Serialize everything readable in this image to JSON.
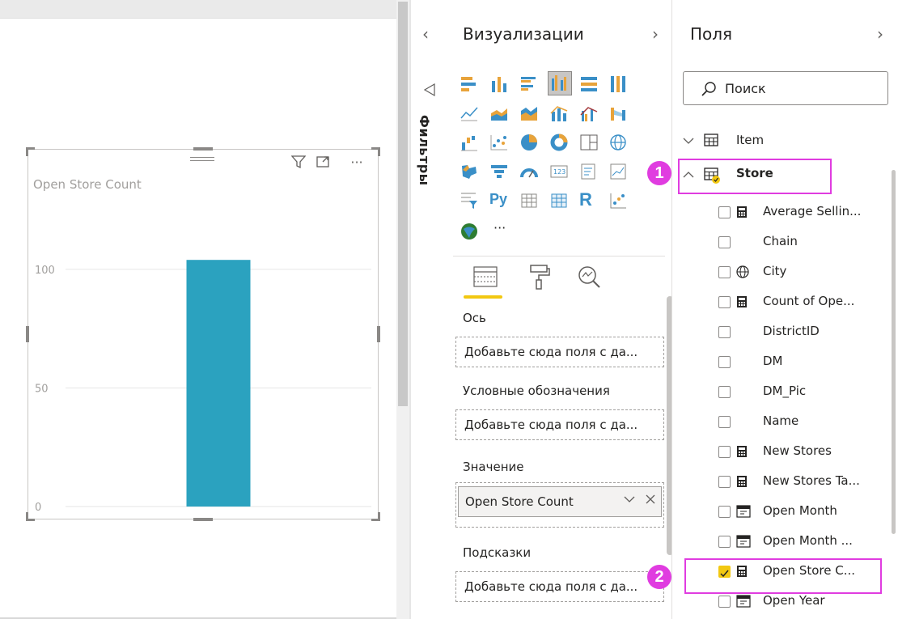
{
  "canvas": {
    "visual": {
      "title": "Open Store Count",
      "icons": [
        "drag-grip-icon",
        "filter-icon",
        "focus-mode-icon",
        "more-options-icon"
      ],
      "more_glyph": "···"
    }
  },
  "chart_data": {
    "type": "bar",
    "title": "Open Store Count",
    "categories": [
      ""
    ],
    "values": [
      104
    ],
    "ylim": [
      0,
      130
    ],
    "yticks": [
      0,
      50,
      100
    ],
    "ytick_labels": [
      "0",
      "50",
      "100"
    ],
    "xlabel": "",
    "ylabel": "",
    "grid": true,
    "bar_color": "#2ba2bf"
  },
  "visualizations": {
    "collapse_glyph": "‹",
    "filters_label": "Фильтры",
    "title": "Визуализации",
    "expand_glyph": "›",
    "more_glyph": "···",
    "tabs": [
      "fields-tab",
      "format-tab",
      "analytics-tab"
    ],
    "wells": [
      {
        "label": "Ось",
        "placeholder": "Добавьте сюда поля с да..."
      },
      {
        "label": "Условные обозначения",
        "placeholder": "Добавьте сюда поля с да..."
      },
      {
        "label": "Значение",
        "chip": "Open Store Count"
      },
      {
        "label": "Подсказки",
        "placeholder": "Добавьте сюда поля с да..."
      }
    ]
  },
  "fields": {
    "title": "Поля",
    "expand_glyph": "›",
    "search_placeholder": "Поиск",
    "tables": [
      {
        "name": "Item",
        "expanded": false
      },
      {
        "name": "Store",
        "expanded": true
      }
    ],
    "store_fields": [
      {
        "name": "Average Sellin...",
        "icon": "calculator-icon",
        "checked": false
      },
      {
        "name": "Chain",
        "icon": "",
        "checked": false
      },
      {
        "name": "City",
        "icon": "globe-icon",
        "checked": false
      },
      {
        "name": "Count of Ope...",
        "icon": "calculator-icon",
        "checked": false
      },
      {
        "name": "DistrictID",
        "icon": "",
        "checked": false
      },
      {
        "name": "DM",
        "icon": "",
        "checked": false
      },
      {
        "name": "DM_Pic",
        "icon": "",
        "checked": false
      },
      {
        "name": "Name",
        "icon": "",
        "checked": false
      },
      {
        "name": "New Stores",
        "icon": "calculator-icon",
        "checked": false
      },
      {
        "name": "New Stores Ta...",
        "icon": "calculator-icon",
        "checked": false
      },
      {
        "name": "Open Month",
        "icon": "date-hierarchy-icon",
        "checked": false
      },
      {
        "name": "Open Month ...",
        "icon": "date-hierarchy-icon",
        "checked": false
      },
      {
        "name": "Open Store C...",
        "icon": "calculator-icon",
        "checked": true
      },
      {
        "name": "Open Year",
        "icon": "date-hierarchy-icon",
        "checked": false
      }
    ]
  },
  "annotations": {
    "badge_1": "1",
    "badge_2": "2",
    "color": "#e03ce0"
  },
  "colors": {
    "accent": "#f2c811",
    "bar": "#2ba2bf",
    "highlight": "#e03ce0"
  }
}
